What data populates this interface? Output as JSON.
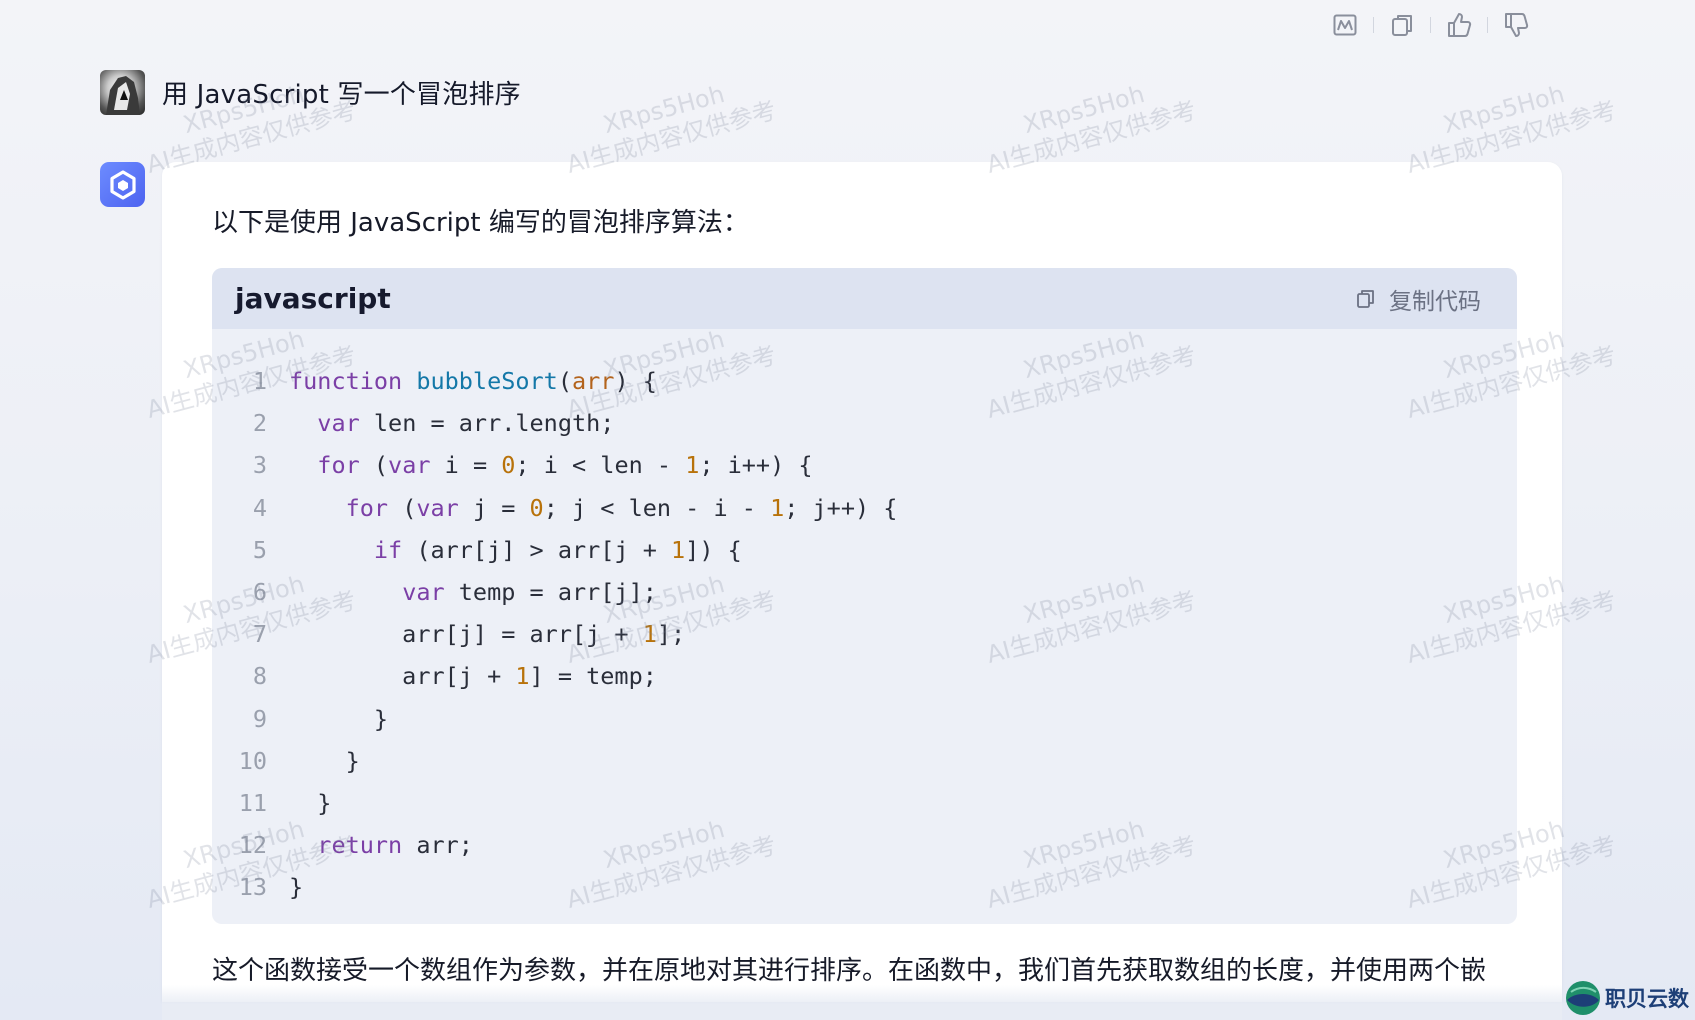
{
  "toolbar": {
    "icons": [
      "chart-icon",
      "copy-icon",
      "thumbs-up-icon",
      "thumbs-down-icon"
    ]
  },
  "user_message": {
    "text": "用 JavaScript 写一个冒泡排序"
  },
  "answer": {
    "intro": "以下是使用 JavaScript 编写的冒泡排序算法：",
    "code_block": {
      "language": "javascript",
      "copy_label": "复制代码",
      "lines": [
        {
          "n": "1",
          "code": "function bubbleSort(arr) {"
        },
        {
          "n": "2",
          "code": "  var len = arr.length;"
        },
        {
          "n": "3",
          "code": "  for (var i = 0; i < len - 1; i++) {"
        },
        {
          "n": "4",
          "code": "    for (var j = 0; j < len - i - 1; j++) {"
        },
        {
          "n": "5",
          "code": "      if (arr[j] > arr[j + 1]) {"
        },
        {
          "n": "6",
          "code": "        var temp = arr[j];"
        },
        {
          "n": "7",
          "code": "        arr[j] = arr[j + 1];"
        },
        {
          "n": "8",
          "code": "        arr[j + 1] = temp;"
        },
        {
          "n": "9",
          "code": "      }"
        },
        {
          "n": "10",
          "code": "    }"
        },
        {
          "n": "11",
          "code": "  }"
        },
        {
          "n": "12",
          "code": "  return arr;"
        },
        {
          "n": "13",
          "code": "}"
        }
      ]
    },
    "outro": "这个函数接受一个数组作为参数，并在原地对其进行排序。在函数中，我们首先获取数组的长度，并使用两个嵌"
  },
  "watermark": {
    "line1": "XRps5Hoh",
    "line2": "AI生成内容仅供参考"
  },
  "brand": {
    "name": "职贝云数"
  },
  "colors": {
    "accent": "#5b73f5",
    "code_bg": "#edf0f7",
    "code_header_bg": "#dde3f1",
    "keyword": "#7b3fa6",
    "function_name": "#1478a8",
    "param": "#b3631c",
    "number": "#b8720a"
  }
}
